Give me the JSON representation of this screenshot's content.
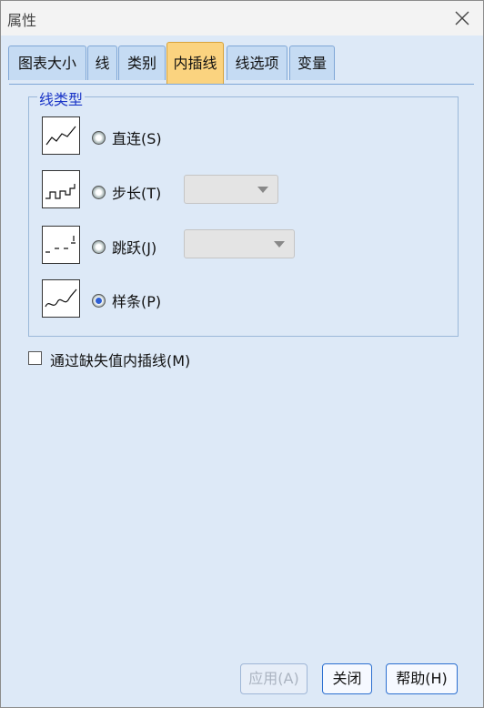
{
  "window": {
    "title": "属性"
  },
  "tabs": [
    {
      "label": "图表大小"
    },
    {
      "label": "线"
    },
    {
      "label": "类别"
    },
    {
      "label": "内插线"
    },
    {
      "label": "线选项"
    },
    {
      "label": "变量"
    }
  ],
  "line_type_group": {
    "legend": "线类型",
    "options": [
      {
        "label": "直连(S)",
        "selected": false
      },
      {
        "label": "步长(T)",
        "selected": false
      },
      {
        "label": "跳跃(J)",
        "selected": false
      },
      {
        "label": "样条(P)",
        "selected": true
      }
    ],
    "step_dropdown": {
      "value": ""
    },
    "jump_dropdown": {
      "value": ""
    }
  },
  "interpolate_missing": {
    "label": "通过缺失值内插线(M)",
    "checked": false
  },
  "buttons": {
    "apply": "应用(A)",
    "close": "关闭",
    "help": "帮助(H)"
  },
  "colors": {
    "active_tab": "#fbd37f",
    "inactive_tab": "#c5dbf3",
    "group_legend": "#1a35c7",
    "button_border": "#2b6fd0"
  }
}
